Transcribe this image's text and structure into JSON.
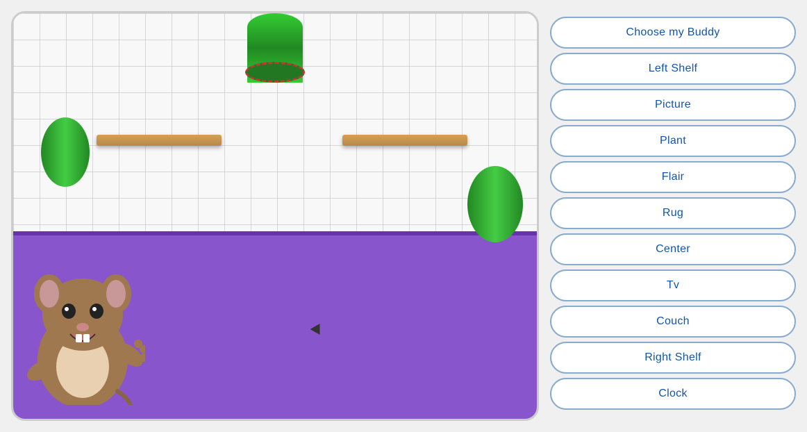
{
  "buttons": [
    {
      "id": "choose-buddy",
      "label": "Choose my Buddy"
    },
    {
      "id": "left-shelf",
      "label": "Left Shelf"
    },
    {
      "id": "picture",
      "label": "Picture"
    },
    {
      "id": "plant",
      "label": "Plant"
    },
    {
      "id": "flair",
      "label": "Flair"
    },
    {
      "id": "rug",
      "label": "Rug"
    },
    {
      "id": "center",
      "label": "Center"
    },
    {
      "id": "tv",
      "label": "Tv"
    },
    {
      "id": "couch",
      "label": "Couch"
    },
    {
      "id": "right-shelf",
      "label": "Right Shelf"
    },
    {
      "id": "clock",
      "label": "Clock"
    }
  ]
}
